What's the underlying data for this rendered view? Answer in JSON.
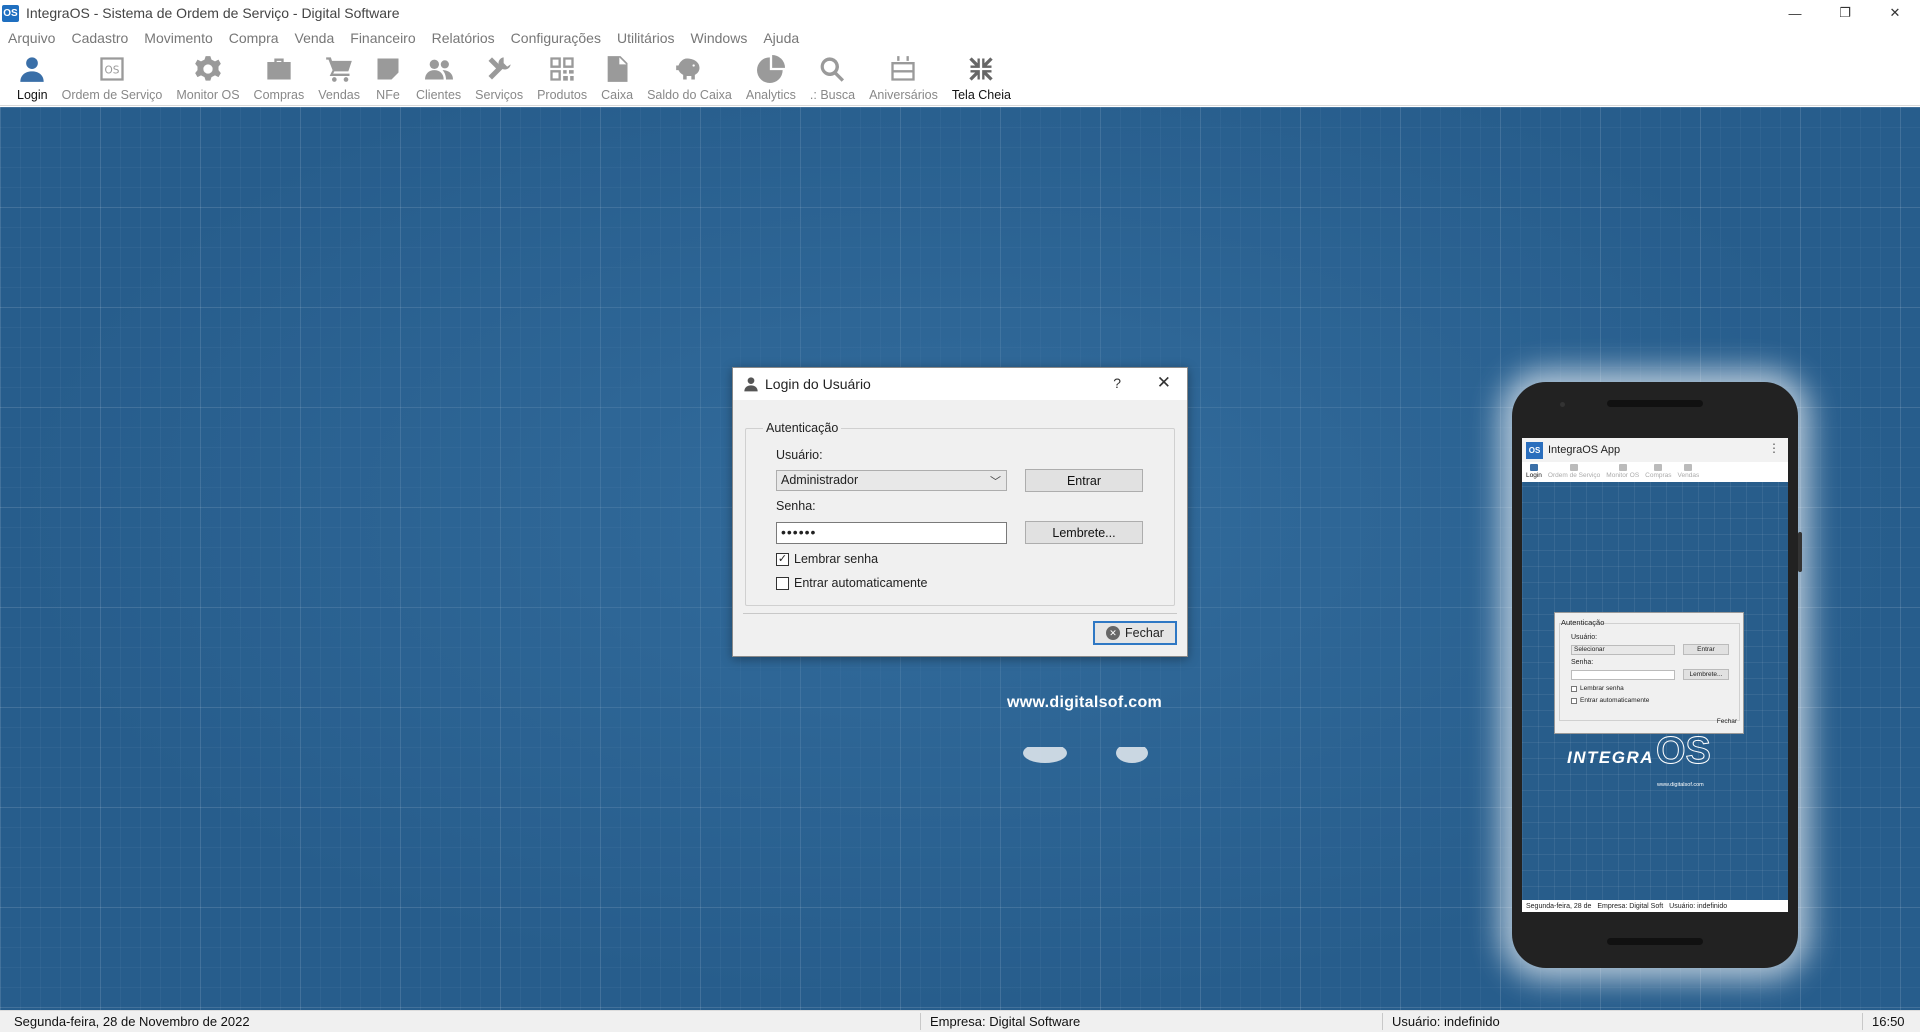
{
  "window": {
    "icon_text": "OS",
    "title": "IntegraOS - Sistema de Ordem de Serviço - Digital Software",
    "controls": {
      "minimize": "—",
      "restore": "❐",
      "close": "✕"
    }
  },
  "menu": [
    "Arquivo",
    "Cadastro",
    "Movimento",
    "Compra",
    "Venda",
    "Financeiro",
    "Relatórios",
    "Configurações",
    "Utilitários",
    "Windows",
    "Ajuda"
  ],
  "toolbar": [
    {
      "label": "Login",
      "icon": "person-icon"
    },
    {
      "label": "Ordem de Serviço",
      "icon": "os-icon"
    },
    {
      "label": "Monitor OS",
      "icon": "gear-icon"
    },
    {
      "label": "Compras",
      "icon": "briefcase-icon"
    },
    {
      "label": "Vendas",
      "icon": "cart-icon"
    },
    {
      "label": "NFe",
      "icon": "note-icon"
    },
    {
      "label": "Clientes",
      "icon": "people-icon"
    },
    {
      "label": "Serviços",
      "icon": "tools-icon"
    },
    {
      "label": "Produtos",
      "icon": "qrcode-icon"
    },
    {
      "label": "Caixa",
      "icon": "document-icon"
    },
    {
      "label": "Saldo do Caixa",
      "icon": "piggy-icon"
    },
    {
      "label": "Analytics",
      "icon": "pie-chart-icon"
    },
    {
      "label": ".: Busca",
      "icon": "search-icon"
    },
    {
      "label": "Aniversários",
      "icon": "cake-icon"
    },
    {
      "label": "Tela Cheia",
      "icon": "fullscreen-exit-icon"
    }
  ],
  "desktop": {
    "website": "www.digitalsof.com"
  },
  "login_dialog": {
    "title": "Login do Usuário",
    "help": "?",
    "close": "✕",
    "group": "Autenticação",
    "user_label": "Usuário:",
    "user_value": "Administrador",
    "password_label": "Senha:",
    "password_value": "••••••",
    "enter_button": "Entrar",
    "reminder_button": "Lembrete...",
    "remember_password": {
      "label": "Lembrar senha",
      "checked": true
    },
    "auto_login": {
      "label": "Entrar automaticamente",
      "checked": false
    },
    "close_button": "Fechar"
  },
  "phone": {
    "app_icon": "OS",
    "app_title": "IntegraOS App",
    "menu_dots": "⋮",
    "tools": [
      "Login",
      "Ordem de Serviço",
      "Monitor OS",
      "Compras",
      "Vendas"
    ],
    "group": "Autenticação",
    "user_label": "Usuário:",
    "user_value": "Selecionar",
    "password_label": "Senha:",
    "enter_button": "Entrar",
    "reminder_button": "Lembrete...",
    "remember_password": "Lembrar senha",
    "auto_login": "Entrar automaticamente",
    "close_button": "Fechar",
    "logo_integra": "INTEGRA",
    "logo_os": "OS",
    "logo_url": "www.digitalsof.com",
    "status": [
      "Segunda-feira, 28 de",
      "Empresa: Digital Soft",
      "Usuário: indefinido"
    ]
  },
  "statusbar": {
    "date": "Segunda-feira, 28 de Novembro de 2022",
    "company": "Empresa: Digital Software",
    "user": "Usuário: indefinido",
    "time": "16:50"
  },
  "colors": {
    "accent": "#3a6fa8",
    "desktop_bg": "#275d8c",
    "focus_border": "#2f78c4"
  }
}
